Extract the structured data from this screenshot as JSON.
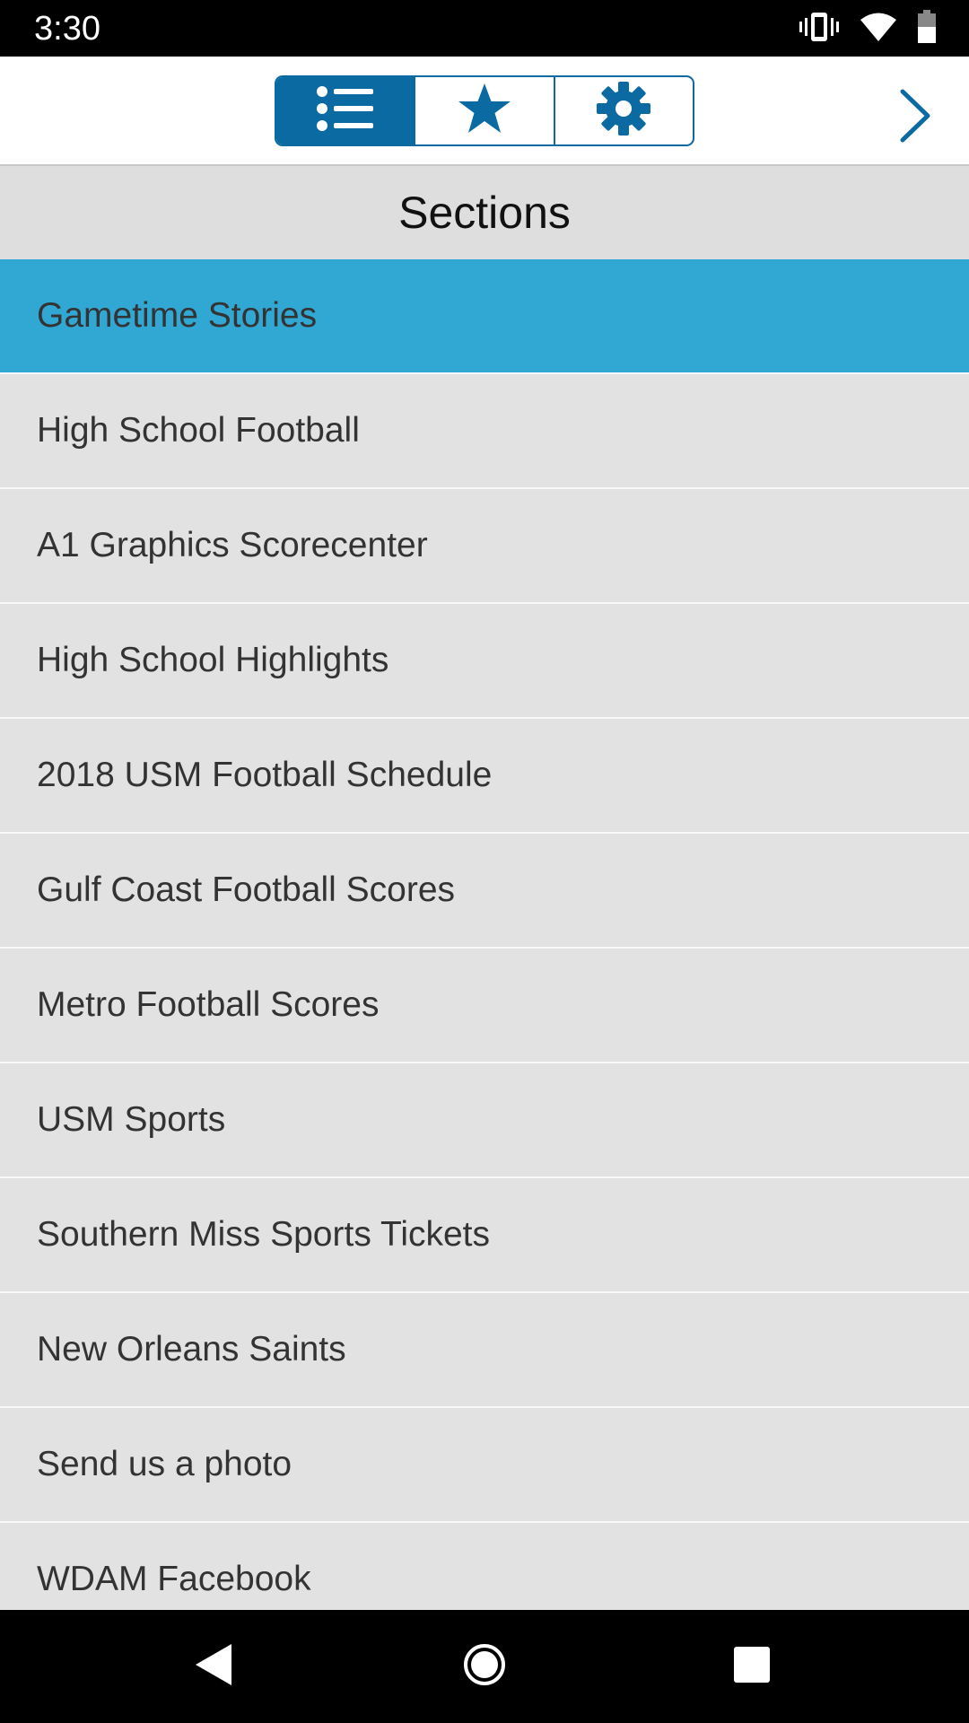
{
  "status_bar": {
    "time": "3:30",
    "icons": [
      "vibrate-icon",
      "wifi-icon",
      "battery-icon"
    ]
  },
  "toolbar": {
    "tabs": [
      {
        "icon": "list-icon",
        "active": true
      },
      {
        "icon": "star-icon",
        "active": false
      },
      {
        "icon": "gear-icon",
        "active": false
      }
    ],
    "next_icon": "chevron-right-icon",
    "accent_color": "#0b6aa2"
  },
  "sections": {
    "title": "Sections",
    "selected_color": "#31a8d4",
    "items": [
      {
        "label": "Gametime Stories",
        "selected": true
      },
      {
        "label": "High School Football",
        "selected": false
      },
      {
        "label": "A1 Graphics Scorecenter",
        "selected": false
      },
      {
        "label": "High School Highlights",
        "selected": false
      },
      {
        "label": "2018 USM Football Schedule",
        "selected": false
      },
      {
        "label": "Gulf Coast Football Scores",
        "selected": false
      },
      {
        "label": "Metro Football Scores",
        "selected": false
      },
      {
        "label": "USM Sports",
        "selected": false
      },
      {
        "label": "Southern Miss Sports Tickets",
        "selected": false
      },
      {
        "label": "New Orleans Saints",
        "selected": false
      },
      {
        "label": "Send us a photo",
        "selected": false
      },
      {
        "label": "WDAM Facebook",
        "selected": false
      }
    ]
  },
  "nav_bar": {
    "icons": [
      "back-icon",
      "home-icon",
      "recents-icon"
    ]
  }
}
